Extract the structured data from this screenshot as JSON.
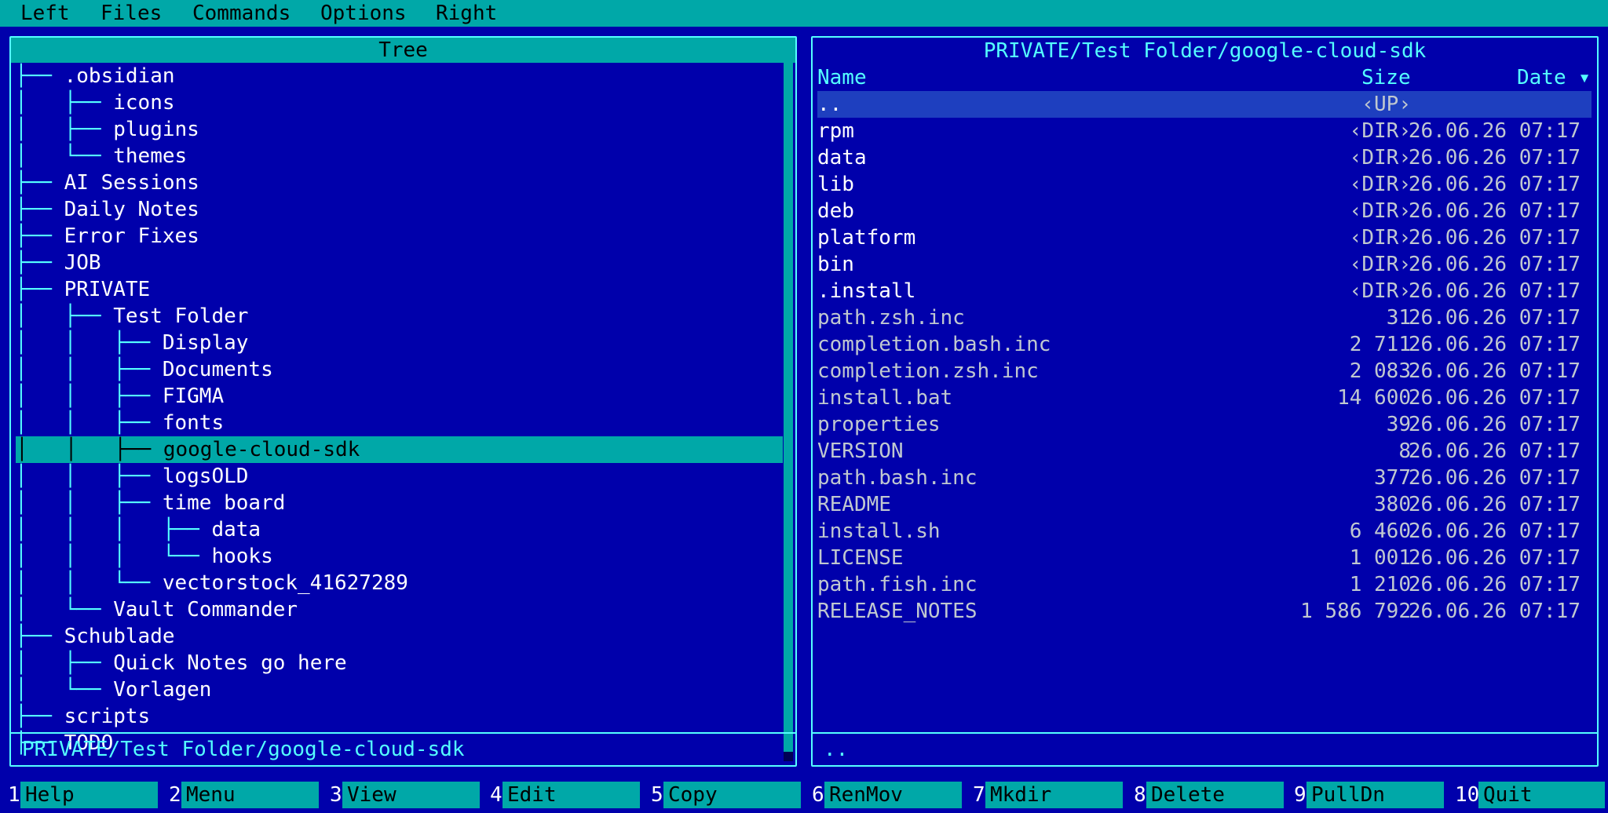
{
  "menu": [
    "Left",
    "Files",
    "Commands",
    "Options",
    "Right"
  ],
  "left_panel": {
    "header": "Tree",
    "status": "PRIVATE/Test Folder/google-cloud-sdk",
    "tree": [
      {
        "lines": "├── ",
        "label": ".obsidian",
        "indent": 0
      },
      {
        "lines": "│   ├── ",
        "label": "icons",
        "indent": 0
      },
      {
        "lines": "│   ├── ",
        "label": "plugins",
        "indent": 0
      },
      {
        "lines": "│   └── ",
        "label": "themes",
        "indent": 0
      },
      {
        "lines": "├── ",
        "label": "AI Sessions",
        "indent": 0
      },
      {
        "lines": "├── ",
        "label": "Daily Notes",
        "indent": 0
      },
      {
        "lines": "├── ",
        "label": "Error Fixes",
        "indent": 0
      },
      {
        "lines": "├── ",
        "label": "JOB",
        "indent": 0
      },
      {
        "lines": "├── ",
        "label": "PRIVATE",
        "indent": 0
      },
      {
        "lines": "│   ├── ",
        "label": "Test Folder",
        "indent": 0
      },
      {
        "lines": "│   │   ├── ",
        "label": "Display",
        "indent": 0
      },
      {
        "lines": "│   │   ├── ",
        "label": "Documents",
        "indent": 0
      },
      {
        "lines": "│   │   ├── ",
        "label": "FIGMA",
        "indent": 0
      },
      {
        "lines": "│   │   ├── ",
        "label": "fonts",
        "indent": 0
      },
      {
        "lines": "│   │   ├── ",
        "label": "google-cloud-sdk",
        "indent": 0,
        "selected": true
      },
      {
        "lines": "│   │   ├── ",
        "label": "logsOLD",
        "indent": 0
      },
      {
        "lines": "│   │   ├── ",
        "label": "time board",
        "indent": 0
      },
      {
        "lines": "│   │   │   ├── ",
        "label": "data",
        "indent": 0
      },
      {
        "lines": "│   │   │   └── ",
        "label": "hooks",
        "indent": 0
      },
      {
        "lines": "│   │   └── ",
        "label": "vectorstock_41627289",
        "indent": 0
      },
      {
        "lines": "│   └── ",
        "label": "Vault Commander",
        "indent": 0
      },
      {
        "lines": "├── ",
        "label": "Schublade",
        "indent": 0
      },
      {
        "lines": "│   ├── ",
        "label": "Quick Notes go here",
        "indent": 0
      },
      {
        "lines": "│   └── ",
        "label": "Vorlagen",
        "indent": 0
      },
      {
        "lines": "├── ",
        "label": "scripts",
        "indent": 0
      },
      {
        "lines": "├── ",
        "label": "TODO",
        "indent": 0
      }
    ]
  },
  "right_panel": {
    "title": "PRIVATE/Test Folder/google-cloud-sdk",
    "columns": {
      "name": "Name",
      "size": "Size",
      "date": "Date ▾"
    },
    "status": "..",
    "files": [
      {
        "name": "..",
        "size": "‹UP›",
        "date": "",
        "kind": "up"
      },
      {
        "name": "rpm",
        "size": "‹DIR›",
        "date": "26.06.26 07:17",
        "kind": "dir"
      },
      {
        "name": "data",
        "size": "‹DIR›",
        "date": "26.06.26 07:17",
        "kind": "dir"
      },
      {
        "name": "lib",
        "size": "‹DIR›",
        "date": "26.06.26 07:17",
        "kind": "dir"
      },
      {
        "name": "deb",
        "size": "‹DIR›",
        "date": "26.06.26 07:17",
        "kind": "dir"
      },
      {
        "name": "platform",
        "size": "‹DIR›",
        "date": "26.06.26 07:17",
        "kind": "dir"
      },
      {
        "name": "bin",
        "size": "‹DIR›",
        "date": "26.06.26 07:17",
        "kind": "dir"
      },
      {
        "name": ".install",
        "size": "‹DIR›",
        "date": "26.06.26 07:17",
        "kind": "dir"
      },
      {
        "name": "path.zsh.inc",
        "size": "31",
        "date": "26.06.26 07:17",
        "kind": "file"
      },
      {
        "name": "completion.bash.inc",
        "size": "2 711",
        "date": "26.06.26 07:17",
        "kind": "file"
      },
      {
        "name": "completion.zsh.inc",
        "size": "2 083",
        "date": "26.06.26 07:17",
        "kind": "file"
      },
      {
        "name": "install.bat",
        "size": "14 600",
        "date": "26.06.26 07:17",
        "kind": "file"
      },
      {
        "name": "properties",
        "size": "39",
        "date": "26.06.26 07:17",
        "kind": "file"
      },
      {
        "name": "VERSION",
        "size": "8",
        "date": "26.06.26 07:17",
        "kind": "file"
      },
      {
        "name": "path.bash.inc",
        "size": "377",
        "date": "26.06.26 07:17",
        "kind": "file"
      },
      {
        "name": "README",
        "size": "380",
        "date": "26.06.26 07:17",
        "kind": "file"
      },
      {
        "name": "install.sh",
        "size": "6 460",
        "date": "26.06.26 07:17",
        "kind": "file"
      },
      {
        "name": "LICENSE",
        "size": "1 001",
        "date": "26.06.26 07:17",
        "kind": "file"
      },
      {
        "name": "path.fish.inc",
        "size": "1 210",
        "date": "26.06.26 07:17",
        "kind": "file"
      },
      {
        "name": "RELEASE_NOTES",
        "size": "1 586 792",
        "date": "26.06.26 07:17",
        "kind": "file"
      }
    ]
  },
  "fkeys": [
    {
      "num": "1",
      "label": "Help"
    },
    {
      "num": "2",
      "label": "Menu"
    },
    {
      "num": "3",
      "label": "View"
    },
    {
      "num": "4",
      "label": "Edit"
    },
    {
      "num": "5",
      "label": "Copy"
    },
    {
      "num": "6",
      "label": "RenMov"
    },
    {
      "num": "7",
      "label": "Mkdir"
    },
    {
      "num": "8",
      "label": "Delete"
    },
    {
      "num": "9",
      "label": "PullDn"
    },
    {
      "num": "10",
      "label": "Quit"
    }
  ],
  "colors": {
    "background": "#0000ab",
    "accent": "#00a8a8",
    "frame": "#55ffff"
  }
}
